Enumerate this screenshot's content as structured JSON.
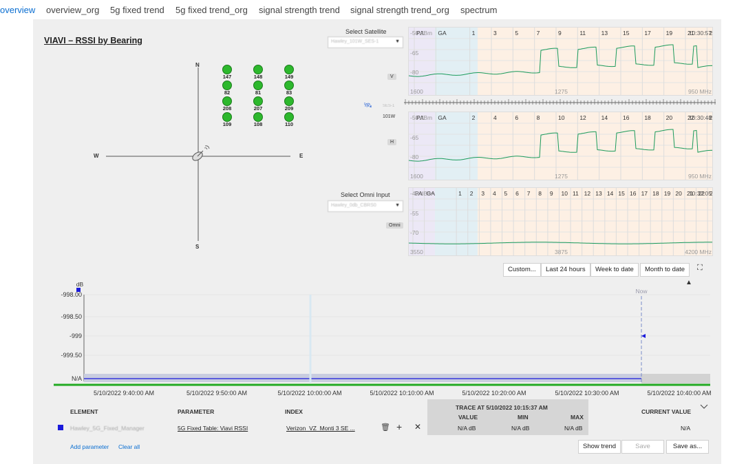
{
  "tabs": [
    {
      "label": "overview",
      "active": true
    },
    {
      "label": "overview_org"
    },
    {
      "label": "5g fixed trend"
    },
    {
      "label": "5g fixed trend_org"
    },
    {
      "label": "signal strength trend"
    },
    {
      "label": "signal strength trend_org"
    },
    {
      "label": "spectrum"
    }
  ],
  "rssi": {
    "title": "VIAVI – RSSI by Bearing",
    "compass": {
      "n": "N",
      "s": "S",
      "e": "E",
      "w": "W"
    },
    "beams": [
      "147",
      "148",
      "149",
      "82",
      "81",
      "83",
      "208",
      "207",
      "209",
      "109",
      "108",
      "110"
    ],
    "beam_color": "#2db82d"
  },
  "satellite": {
    "label": "Select Satellite",
    "value": "Hawley_101W_SES-1",
    "sat_name": "SES-1",
    "sat_pos": "101W",
    "pol_v": "V",
    "pol_h": "H",
    "omni_label": "Select Omni Input",
    "omni_value": "Hawley_0db_CBRS0",
    "omni_tag": "Omni"
  },
  "spectrum_v": {
    "time": "10:30:57",
    "levels": [
      "-50 dBm",
      "-65",
      "-80"
    ],
    "freq_left": "1600",
    "freq_mid": "1275",
    "freq_right": "950 MHz",
    "markers": [
      "PA",
      "GA",
      "1",
      "3",
      "5",
      "7",
      "9",
      "11",
      "13",
      "15",
      "17",
      "19",
      "21",
      "23"
    ]
  },
  "spectrum_h": {
    "time": "10:30:48",
    "levels": [
      "-50 dBm",
      "-65",
      "-80"
    ],
    "freq_left": "1600",
    "freq_mid": "1275",
    "freq_right": "950 MHz",
    "markers": [
      "PA",
      "GA",
      "2",
      "4",
      "6",
      "8",
      "10",
      "12",
      "14",
      "16",
      "18",
      "20",
      "22",
      "24"
    ]
  },
  "spectrum_omni": {
    "time": "10:32:05",
    "levels": [
      "-40 dBm",
      "-55",
      "-70"
    ],
    "freq_left": "3550",
    "freq_mid": "3875",
    "freq_right": "4200 MHz",
    "markers": [
      "PA",
      "GA",
      "1",
      "2",
      "3",
      "4",
      "5",
      "6",
      "7",
      "8",
      "9",
      "10",
      "11",
      "12",
      "13",
      "14",
      "15",
      "16",
      "17",
      "18",
      "19",
      "20",
      "21",
      "22",
      "23",
      "24"
    ]
  },
  "range_buttons": {
    "custom": "Custom...",
    "last24": "Last 24 hours",
    "week": "Week to date",
    "month": "Month to date"
  },
  "trend": {
    "y_unit": "dB",
    "y_ticks": [
      "-998.00",
      "-998.50",
      "-999",
      "-999.50",
      "N/A"
    ],
    "x_ticks": [
      "5/10/2022 9:40:00 AM",
      "5/10/2022 9:50:00 AM",
      "5/10/2022 10:00:00 AM",
      "5/10/2022 10:10:00 AM",
      "5/10/2022 10:20:00 AM",
      "5/10/2022 10:30:00 AM",
      "5/10/2022 10:40:00 AM"
    ],
    "now_label": "Now"
  },
  "table": {
    "col_element": "ELEMENT",
    "col_parameter": "PARAMETER",
    "col_index": "INDEX",
    "trace_header": "TRACE AT 5/10/2022 10:15:37 AM",
    "col_value": "VALUE",
    "col_min": "MIN",
    "col_max": "MAX",
    "col_current": "CURRENT VALUE",
    "row": {
      "element": "Hawley_5G_Fixed_Manager",
      "parameter": "5G Fixed Table: Viavi RSSI",
      "index": "Verizon_VZ_Monti 3 SE ...",
      "value": "N/A dB",
      "min": "N/A dB",
      "max": "N/A dB",
      "current": "N/A",
      "color": "#1a1adb"
    },
    "add_parameter": "Add parameter",
    "clear_all": "Clear all",
    "show_trend": "Show trend",
    "save": "Save",
    "save_as": "Save as..."
  }
}
